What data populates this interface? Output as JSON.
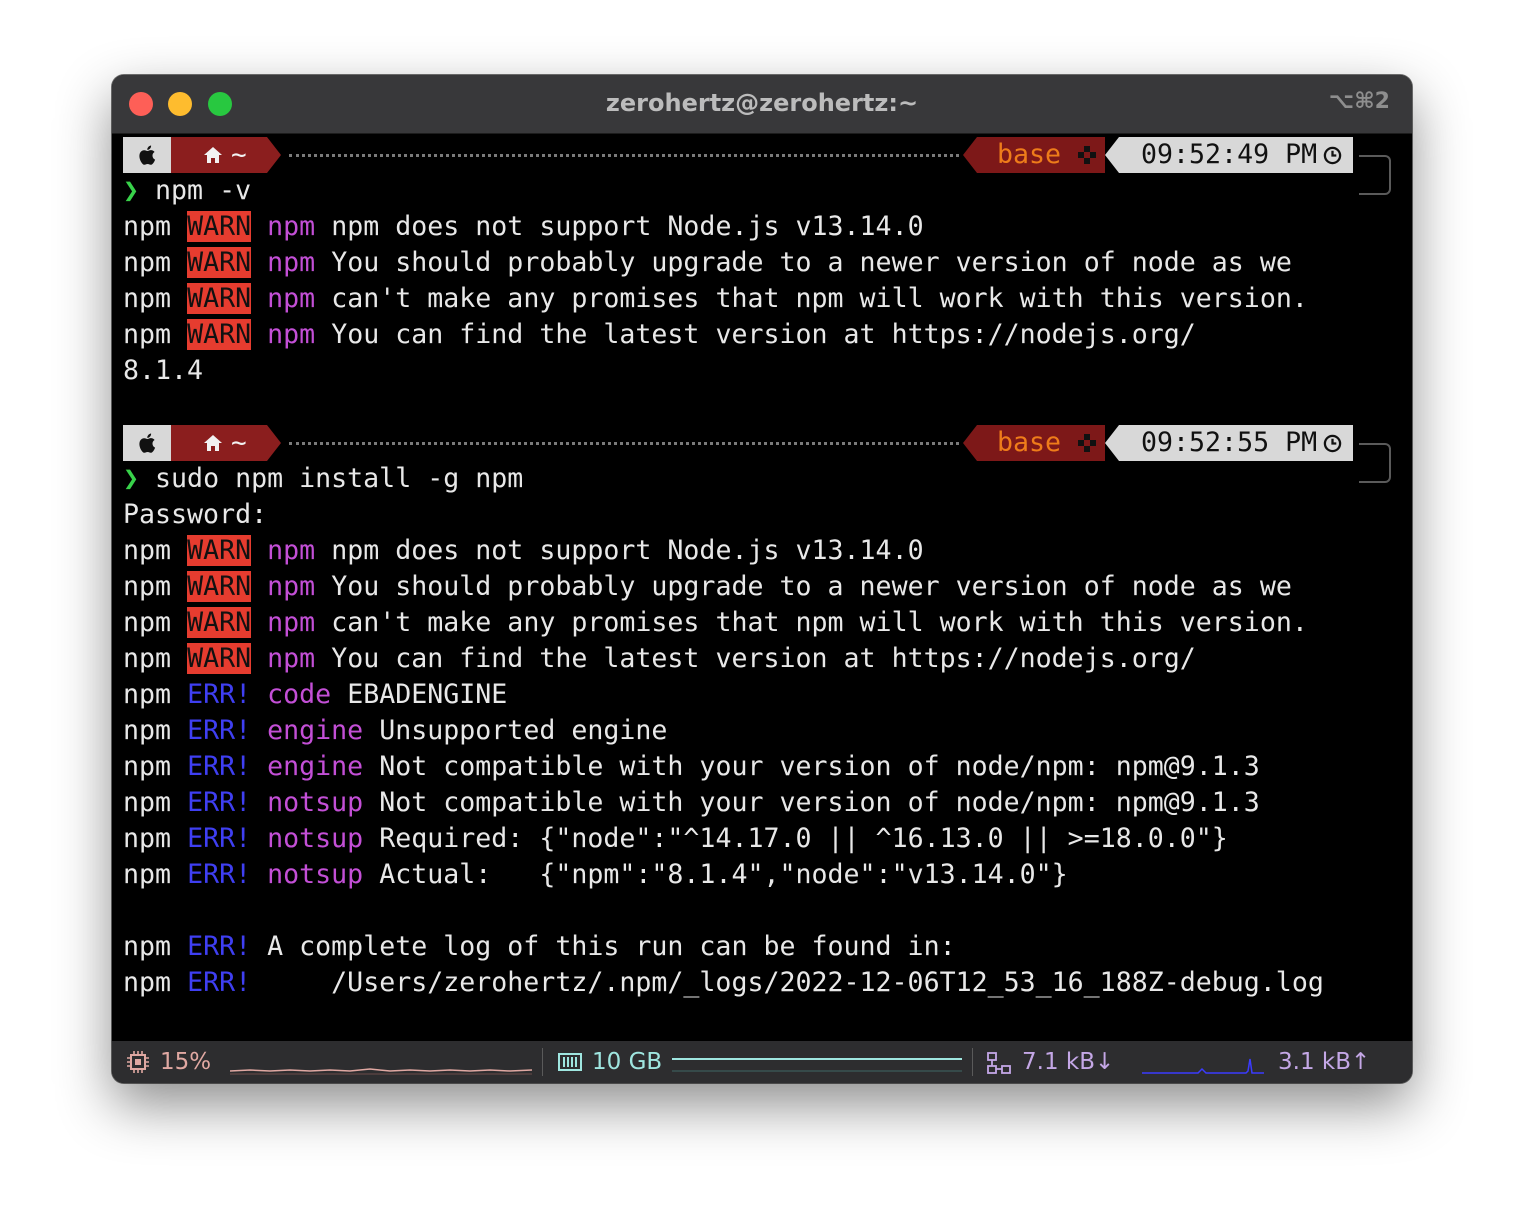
{
  "window": {
    "title": "zerohertz@zerohertz:~",
    "shortcut": "⌥⌘2"
  },
  "prompts": [
    {
      "dir": "~",
      "env": "base",
      "time": "09:52:49 PM"
    },
    {
      "dir": "~",
      "env": "base",
      "time": "09:52:55 PM"
    }
  ],
  "prompt_symbol": "❯",
  "commands": [
    "npm -v",
    "sudo npm install -g npm"
  ],
  "labels": {
    "npm": "npm",
    "warn": "WARN",
    "err": "ERR!",
    "password": "Password:"
  },
  "block1": {
    "warn_lines": [
      {
        "tag": "npm",
        "text": "npm does not support Node.js v13.14.0"
      },
      {
        "tag": "npm",
        "text": "You should probably upgrade to a newer version of node as we"
      },
      {
        "tag": "npm",
        "text": "can't make any promises that npm will work with this version."
      },
      {
        "tag": "npm",
        "text": "You can find the latest version at https://nodejs.org/"
      }
    ],
    "version_output": "8.1.4"
  },
  "block2": {
    "warn_lines": [
      {
        "tag": "npm",
        "text": "npm does not support Node.js v13.14.0"
      },
      {
        "tag": "npm",
        "text": "You should probably upgrade to a newer version of node as we"
      },
      {
        "tag": "npm",
        "text": "can't make any promises that npm will work with this version."
      },
      {
        "tag": "npm",
        "text": "You can find the latest version at https://nodejs.org/"
      }
    ],
    "err_lines": [
      {
        "tag": "code",
        "text": "EBADENGINE"
      },
      {
        "tag": "engine",
        "text": "Unsupported engine"
      },
      {
        "tag": "engine",
        "text": "Not compatible with your version of node/npm: npm@9.1.3"
      },
      {
        "tag": "notsup",
        "text": "Not compatible with your version of node/npm: npm@9.1.3"
      },
      {
        "tag": "notsup",
        "text": "Required: {\"node\":\"^14.17.0 || ^16.13.0 || >=18.0.0\"}"
      },
      {
        "tag": "notsup",
        "text": "Actual:   {\"npm\":\"8.1.4\",\"node\":\"v13.14.0\"}"
      }
    ],
    "log_lines": [
      {
        "text": "A complete log of this run can be found in:"
      },
      {
        "text": "    /Users/zerohertz/.npm/_logs/2022-12-06T12_53_16_188Z-debug.log"
      }
    ]
  },
  "statusbar": {
    "cpu": "15%",
    "memory": "10 GB",
    "net_down": "7.1 kB↓",
    "net_up": "3.1 kB↑",
    "colors": {
      "cpu": "#e0a8a2",
      "memory": "#9fe6e0",
      "network": "#c4a7e6",
      "graph_blue": "#3b3bff"
    }
  },
  "icons": [
    "apple-icon",
    "home-icon",
    "python-icon",
    "clock-icon",
    "cpu-icon",
    "memory-icon",
    "network-icon"
  ]
}
